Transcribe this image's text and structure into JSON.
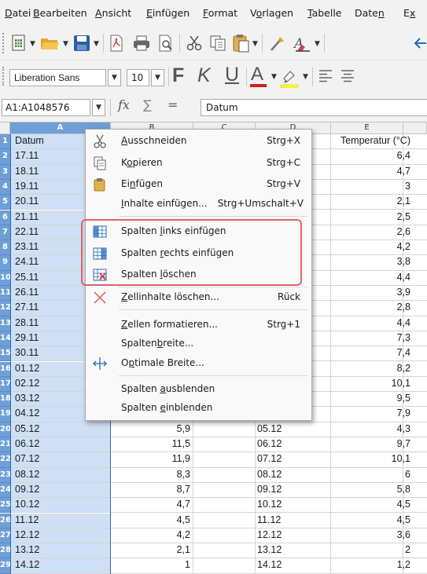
{
  "menubar": [
    {
      "pre": "",
      "u": "D",
      "post": "atei"
    },
    {
      "pre": "",
      "u": "B",
      "post": "earbeiten"
    },
    {
      "pre": "",
      "u": "A",
      "post": "nsicht"
    },
    {
      "pre": "",
      "u": "E",
      "post": "infügen"
    },
    {
      "pre": "",
      "u": "F",
      "post": "ormat"
    },
    {
      "pre": "V",
      "u": "o",
      "post": "rlagen"
    },
    {
      "pre": "",
      "u": "T",
      "post": "abelle"
    },
    {
      "pre": "Date",
      "u": "n",
      "post": ""
    },
    {
      "pre": "E",
      "u": "x",
      "post": ""
    }
  ],
  "toolbar_format": {
    "font_name": "Liberation Sans",
    "font_size": "10",
    "bold": "F",
    "italic": "K",
    "underline": "U",
    "font_color_letter": "A"
  },
  "formula_bar": {
    "name_box": "A1:A1048576",
    "fx": "fx",
    "sum": "∑",
    "equals": "=",
    "content": "Datum"
  },
  "grid": {
    "columns": [
      "A",
      "B",
      "C",
      "D",
      "E"
    ],
    "rows": [
      {
        "n": "1",
        "a": "Datum",
        "b": "",
        "d": "",
        "e": "Temperatur (°C)"
      },
      {
        "n": "2",
        "a": "17.11",
        "b": "",
        "d": "",
        "e": "6,4"
      },
      {
        "n": "3",
        "a": "18.11",
        "b": "",
        "d": "",
        "e": "4,7"
      },
      {
        "n": "4",
        "a": "19.11",
        "b": "",
        "d": "",
        "e": "3"
      },
      {
        "n": "5",
        "a": "20.11",
        "b": "",
        "d": "",
        "e": "2,1"
      },
      {
        "n": "6",
        "a": "21.11",
        "b": "",
        "d": "",
        "e": "2,5"
      },
      {
        "n": "7",
        "a": "22.11",
        "b": "",
        "d": "",
        "e": "2,6"
      },
      {
        "n": "8",
        "a": "23.11",
        "b": "",
        "d": "",
        "e": "4,2"
      },
      {
        "n": "9",
        "a": "24.11",
        "b": "",
        "d": "",
        "e": "3,8"
      },
      {
        "n": "10",
        "a": "25.11",
        "b": "",
        "d": "",
        "e": "4,4"
      },
      {
        "n": "11",
        "a": "26.11",
        "b": "",
        "d": "",
        "e": "3,9"
      },
      {
        "n": "12",
        "a": "27.11",
        "b": "",
        "d": "",
        "e": "2,8"
      },
      {
        "n": "13",
        "a": "28.11",
        "b": "",
        "d": "",
        "e": "4,4"
      },
      {
        "n": "14",
        "a": "29.11",
        "b": "",
        "d": "",
        "e": "7,3"
      },
      {
        "n": "15",
        "a": "30.11",
        "b": "",
        "d": "",
        "e": "7,4"
      },
      {
        "n": "16",
        "a": "01.12",
        "b": "",
        "d": "",
        "e": "8,2"
      },
      {
        "n": "17",
        "a": "02.12",
        "b": "",
        "d": "",
        "e": "10,1"
      },
      {
        "n": "18",
        "a": "03.12",
        "b": "",
        "d": "",
        "e": "9,5"
      },
      {
        "n": "19",
        "a": "04.12",
        "b": "",
        "d": "",
        "e": "7,9"
      },
      {
        "n": "20",
        "a": "05.12",
        "b": "5,9",
        "d": "05.12",
        "e": "4,3"
      },
      {
        "n": "21",
        "a": "06.12",
        "b": "11,5",
        "d": "06.12",
        "e": "9,7"
      },
      {
        "n": "22",
        "a": "07.12",
        "b": "11,9",
        "d": "07.12",
        "e": "10,1"
      },
      {
        "n": "23",
        "a": "08.12",
        "b": "8,3",
        "d": "08.12",
        "e": "6"
      },
      {
        "n": "24",
        "a": "09.12",
        "b": "8,7",
        "d": "09.12",
        "e": "5,8"
      },
      {
        "n": "25",
        "a": "10.12",
        "b": "4,7",
        "d": "10.12",
        "e": "4,5"
      },
      {
        "n": "26",
        "a": "11.12",
        "b": "4,5",
        "d": "11.12",
        "e": "4,5"
      },
      {
        "n": "27",
        "a": "12.12",
        "b": "4,2",
        "d": "12.12",
        "e": "3,6"
      },
      {
        "n": "28",
        "a": "13.12",
        "b": "2,1",
        "d": "13.12",
        "e": "2"
      },
      {
        "n": "29",
        "a": "14.12",
        "b": "1",
        "d": "14.12",
        "e": "1,2"
      }
    ]
  },
  "context_menu": {
    "items": [
      {
        "pre": "",
        "u": "A",
        "post": "usschneiden",
        "shortcut": "Strg+X",
        "icon": "scissors-icon"
      },
      {
        "pre": "K",
        "u": "o",
        "post": "pieren",
        "shortcut": "Strg+C",
        "icon": "copy-icon"
      },
      {
        "pre": "Ei",
        "u": "n",
        "post": "fügen",
        "shortcut": "Strg+V",
        "icon": "paste-icon"
      },
      {
        "pre": "",
        "u": "I",
        "post": "nhalte einfügen...",
        "shortcut": "Strg+Umschalt+V",
        "icon": ""
      },
      {
        "pre": "Spalten ",
        "u": "l",
        "post": "inks einfügen",
        "shortcut": "",
        "icon": "insert-columns-left-icon"
      },
      {
        "pre": "Spalten ",
        "u": "r",
        "post": "echts einfügen",
        "shortcut": "",
        "icon": "insert-columns-right-icon"
      },
      {
        "pre": "Spalten ",
        "u": "l",
        "post": "öschen",
        "shortcut": "",
        "icon": "delete-columns-icon"
      },
      {
        "pre": "",
        "u": "Z",
        "post": "ellinhalte löschen...",
        "shortcut": "Rück",
        "icon": "clear-contents-icon"
      },
      {
        "pre": "",
        "u": "Z",
        "post": "ellen formatieren...",
        "shortcut": "Strg+1",
        "icon": ""
      },
      {
        "pre": "Spalten",
        "u": "b",
        "post": "reite...",
        "shortcut": "",
        "icon": ""
      },
      {
        "pre": "O",
        "u": "p",
        "post": "timale Breite...",
        "shortcut": "",
        "icon": "optimal-width-icon"
      },
      {
        "pre": "Spalten ",
        "u": "a",
        "post": "usblenden",
        "shortcut": "",
        "icon": ""
      },
      {
        "pre": "Spalten ",
        "u": "e",
        "post": "inblenden",
        "shortcut": "",
        "icon": ""
      }
    ]
  },
  "colors": {
    "selection": "#6e9fd6",
    "selected_cells": "#cfe0f5",
    "highlight_box": "#e0616b"
  }
}
